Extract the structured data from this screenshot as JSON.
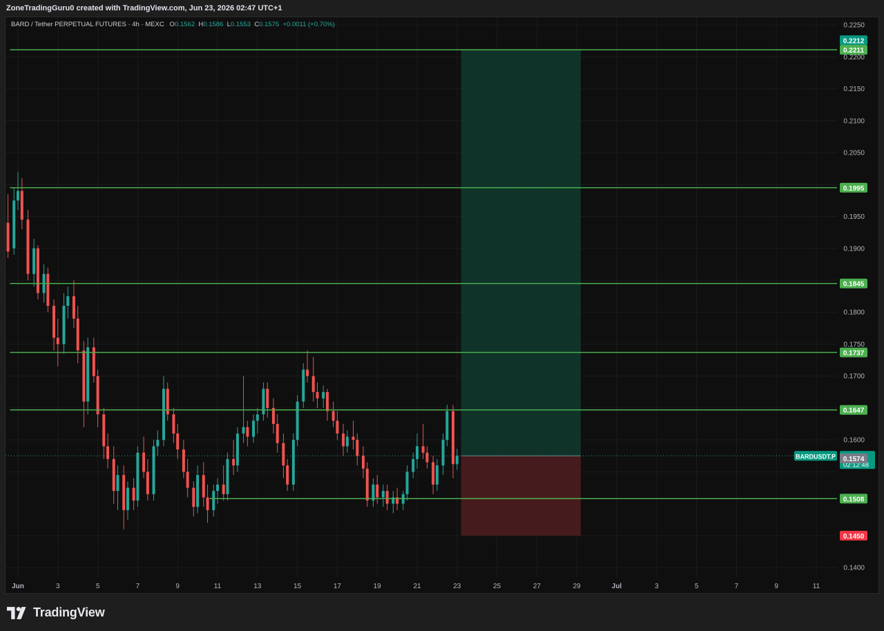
{
  "header": {
    "attribution": "ZoneTradingGuru0 created with TradingView.com, Jun 23, 2026 02:47 UTC+1"
  },
  "legend": {
    "symbol": "BARD / Tether PERPETUAL FUTURES · 4h · MEXC",
    "open_label": "O",
    "open": "0.1562",
    "high_label": "H",
    "high": "0.1586",
    "low_label": "L",
    "low": "0.1553",
    "close_label": "C",
    "close": "0.1575",
    "change": "+0.0011 (+0.70%)"
  },
  "footer": {
    "brand": "TradingView"
  },
  "colors": {
    "up": "#26a69a",
    "down": "#ef5350",
    "level": "#4caf50",
    "target_zone": "#0f3a2e",
    "stop_zone": "#4a1c1f",
    "label_green": "#4caf50",
    "label_teal": "#089981",
    "label_red": "#f23645",
    "label_gray": "#787b86"
  },
  "chart_data": {
    "type": "candlestick",
    "interval": "4h",
    "ylim": [
      0.1385,
      0.2262
    ],
    "y_ticks": [
      0.225,
      0.22,
      0.215,
      0.21,
      0.205,
      0.195,
      0.19,
      0.18,
      0.175,
      0.17,
      0.16,
      0.14
    ],
    "x_ticks": [
      {
        "label": "Jun",
        "day": 1
      },
      {
        "label": "3",
        "day": 3
      },
      {
        "label": "5",
        "day": 5
      },
      {
        "label": "7",
        "day": 7
      },
      {
        "label": "9",
        "day": 9
      },
      {
        "label": "11",
        "day": 11
      },
      {
        "label": "13",
        "day": 13
      },
      {
        "label": "15",
        "day": 15
      },
      {
        "label": "17",
        "day": 17
      },
      {
        "label": "19",
        "day": 19
      },
      {
        "label": "21",
        "day": 21
      },
      {
        "label": "23",
        "day": 23
      },
      {
        "label": "25",
        "day": 25
      },
      {
        "label": "27",
        "day": 27
      },
      {
        "label": "29",
        "day": 29
      },
      {
        "label": "Jul",
        "day": 31
      },
      {
        "label": "3",
        "day": 33
      },
      {
        "label": "5",
        "day": 35
      },
      {
        "label": "7",
        "day": 37
      },
      {
        "label": "9",
        "day": 39
      },
      {
        "label": "11",
        "day": 41
      }
    ],
    "horizontal_levels": [
      {
        "price": 0.2211,
        "label": "0.2211",
        "from_day": 0.6
      },
      {
        "price": 0.1995,
        "label": "0.1995",
        "from_day": 0.6
      },
      {
        "price": 0.1845,
        "label": "0.1845",
        "from_day": 0.6
      },
      {
        "price": 0.1737,
        "label": "0.1737",
        "from_day": 0.6
      },
      {
        "price": 0.1647,
        "label": "0.1647",
        "from_day": 0.6
      },
      {
        "price": 0.1508,
        "label": "0.1508",
        "from_day": 10.6
      }
    ],
    "position": {
      "type": "long",
      "entry": 0.1575,
      "target": 0.2212,
      "stop": 0.145,
      "start_day": 23.2,
      "end_day": 29.2
    },
    "price_labels": [
      {
        "text": "0.2212",
        "price": 0.2226,
        "color": "label_teal"
      },
      {
        "text": "0.2211",
        "price": 0.2211,
        "color": "label_green"
      },
      {
        "text": "0.1995",
        "price": 0.1995,
        "color": "label_green"
      },
      {
        "text": "0.1845",
        "price": 0.1845,
        "color": "label_green"
      },
      {
        "text": "0.1737",
        "price": 0.1737,
        "color": "label_green"
      },
      {
        "text": "0.1647",
        "price": 0.1647,
        "color": "label_green"
      },
      {
        "text": "0.1508",
        "price": 0.1508,
        "color": "label_green"
      },
      {
        "text": "0.1450",
        "price": 0.145,
        "color": "label_red"
      }
    ],
    "last_price": {
      "symbol": "BARDUSDT.P",
      "price": "0.1575",
      "countdown": "02:12:48",
      "price_value": 0.1575
    },
    "mark_price": {
      "text": "0.1574",
      "price": 0.1574
    },
    "candles": [
      {
        "d": 0.5,
        "o": 0.194,
        "h": 0.1985,
        "l": 0.1885,
        "c": 0.1895
      },
      {
        "d": 0.8,
        "o": 0.19,
        "h": 0.1995,
        "l": 0.189,
        "c": 0.1975
      },
      {
        "d": 1.0,
        "o": 0.1975,
        "h": 0.202,
        "l": 0.196,
        "c": 0.199
      },
      {
        "d": 1.2,
        "o": 0.199,
        "h": 0.201,
        "l": 0.193,
        "c": 0.1945
      },
      {
        "d": 1.5,
        "o": 0.1945,
        "h": 0.196,
        "l": 0.185,
        "c": 0.186
      },
      {
        "d": 1.8,
        "o": 0.186,
        "h": 0.1915,
        "l": 0.184,
        "c": 0.19
      },
      {
        "d": 2.0,
        "o": 0.19,
        "h": 0.1905,
        "l": 0.182,
        "c": 0.183
      },
      {
        "d": 2.3,
        "o": 0.183,
        "h": 0.1875,
        "l": 0.1815,
        "c": 0.186
      },
      {
        "d": 2.5,
        "o": 0.186,
        "h": 0.187,
        "l": 0.18,
        "c": 0.181
      },
      {
        "d": 2.8,
        "o": 0.181,
        "h": 0.182,
        "l": 0.174,
        "c": 0.176
      },
      {
        "d": 3.0,
        "o": 0.176,
        "h": 0.179,
        "l": 0.1715,
        "c": 0.175
      },
      {
        "d": 3.3,
        "o": 0.175,
        "h": 0.183,
        "l": 0.1735,
        "c": 0.181
      },
      {
        "d": 3.5,
        "o": 0.181,
        "h": 0.184,
        "l": 0.179,
        "c": 0.1825
      },
      {
        "d": 3.8,
        "o": 0.1825,
        "h": 0.185,
        "l": 0.1775,
        "c": 0.179
      },
      {
        "d": 4.0,
        "o": 0.179,
        "h": 0.181,
        "l": 0.172,
        "c": 0.174
      },
      {
        "d": 4.3,
        "o": 0.174,
        "h": 0.1755,
        "l": 0.162,
        "c": 0.166
      },
      {
        "d": 4.5,
        "o": 0.166,
        "h": 0.176,
        "l": 0.164,
        "c": 0.1745
      },
      {
        "d": 4.8,
        "o": 0.1745,
        "h": 0.176,
        "l": 0.169,
        "c": 0.17
      },
      {
        "d": 5.0,
        "o": 0.17,
        "h": 0.171,
        "l": 0.162,
        "c": 0.164
      },
      {
        "d": 5.3,
        "o": 0.164,
        "h": 0.165,
        "l": 0.157,
        "c": 0.159
      },
      {
        "d": 5.5,
        "o": 0.159,
        "h": 0.161,
        "l": 0.1555,
        "c": 0.157
      },
      {
        "d": 5.8,
        "o": 0.157,
        "h": 0.159,
        "l": 0.15,
        "c": 0.152
      },
      {
        "d": 6.0,
        "o": 0.152,
        "h": 0.156,
        "l": 0.149,
        "c": 0.1545
      },
      {
        "d": 6.3,
        "o": 0.1545,
        "h": 0.156,
        "l": 0.146,
        "c": 0.149
      },
      {
        "d": 6.5,
        "o": 0.149,
        "h": 0.1535,
        "l": 0.1475,
        "c": 0.1525
      },
      {
        "d": 6.8,
        "o": 0.1525,
        "h": 0.154,
        "l": 0.149,
        "c": 0.1505
      },
      {
        "d": 7.0,
        "o": 0.1505,
        "h": 0.159,
        "l": 0.1495,
        "c": 0.158
      },
      {
        "d": 7.3,
        "o": 0.158,
        "h": 0.1605,
        "l": 0.154,
        "c": 0.155
      },
      {
        "d": 7.5,
        "o": 0.155,
        "h": 0.157,
        "l": 0.1505,
        "c": 0.1515
      },
      {
        "d": 7.8,
        "o": 0.1515,
        "h": 0.16,
        "l": 0.1505,
        "c": 0.159
      },
      {
        "d": 8.0,
        "o": 0.159,
        "h": 0.1615,
        "l": 0.1575,
        "c": 0.16
      },
      {
        "d": 8.3,
        "o": 0.16,
        "h": 0.17,
        "l": 0.159,
        "c": 0.168
      },
      {
        "d": 8.5,
        "o": 0.168,
        "h": 0.169,
        "l": 0.163,
        "c": 0.164
      },
      {
        "d": 8.8,
        "o": 0.164,
        "h": 0.165,
        "l": 0.1595,
        "c": 0.161
      },
      {
        "d": 9.0,
        "o": 0.161,
        "h": 0.1625,
        "l": 0.157,
        "c": 0.1585
      },
      {
        "d": 9.3,
        "o": 0.1585,
        "h": 0.16,
        "l": 0.154,
        "c": 0.155
      },
      {
        "d": 9.5,
        "o": 0.155,
        "h": 0.157,
        "l": 0.151,
        "c": 0.1525
      },
      {
        "d": 9.8,
        "o": 0.1525,
        "h": 0.1535,
        "l": 0.148,
        "c": 0.1495
      },
      {
        "d": 10.0,
        "o": 0.1495,
        "h": 0.156,
        "l": 0.1485,
        "c": 0.1545
      },
      {
        "d": 10.3,
        "o": 0.1545,
        "h": 0.1565,
        "l": 0.1495,
        "c": 0.151
      },
      {
        "d": 10.5,
        "o": 0.151,
        "h": 0.153,
        "l": 0.147,
        "c": 0.149
      },
      {
        "d": 10.8,
        "o": 0.149,
        "h": 0.153,
        "l": 0.148,
        "c": 0.152
      },
      {
        "d": 11.0,
        "o": 0.152,
        "h": 0.154,
        "l": 0.15,
        "c": 0.153
      },
      {
        "d": 11.3,
        "o": 0.153,
        "h": 0.156,
        "l": 0.1505,
        "c": 0.1515
      },
      {
        "d": 11.5,
        "o": 0.1515,
        "h": 0.158,
        "l": 0.1505,
        "c": 0.157
      },
      {
        "d": 11.8,
        "o": 0.157,
        "h": 0.16,
        "l": 0.1545,
        "c": 0.156
      },
      {
        "d": 12.0,
        "o": 0.156,
        "h": 0.162,
        "l": 0.155,
        "c": 0.161
      },
      {
        "d": 12.3,
        "o": 0.161,
        "h": 0.17,
        "l": 0.1595,
        "c": 0.162
      },
      {
        "d": 12.5,
        "o": 0.162,
        "h": 0.163,
        "l": 0.159,
        "c": 0.1605
      },
      {
        "d": 12.8,
        "o": 0.1605,
        "h": 0.164,
        "l": 0.1595,
        "c": 0.163
      },
      {
        "d": 13.0,
        "o": 0.163,
        "h": 0.165,
        "l": 0.161,
        "c": 0.164
      },
      {
        "d": 13.3,
        "o": 0.164,
        "h": 0.169,
        "l": 0.163,
        "c": 0.168
      },
      {
        "d": 13.5,
        "o": 0.168,
        "h": 0.169,
        "l": 0.1635,
        "c": 0.165
      },
      {
        "d": 13.8,
        "o": 0.165,
        "h": 0.1665,
        "l": 0.161,
        "c": 0.1625
      },
      {
        "d": 14.0,
        "o": 0.1625,
        "h": 0.164,
        "l": 0.158,
        "c": 0.1595
      },
      {
        "d": 14.3,
        "o": 0.1595,
        "h": 0.161,
        "l": 0.154,
        "c": 0.156
      },
      {
        "d": 14.5,
        "o": 0.156,
        "h": 0.157,
        "l": 0.152,
        "c": 0.153
      },
      {
        "d": 14.8,
        "o": 0.153,
        "h": 0.161,
        "l": 0.152,
        "c": 0.16
      },
      {
        "d": 15.0,
        "o": 0.16,
        "h": 0.167,
        "l": 0.159,
        "c": 0.166
      },
      {
        "d": 15.3,
        "o": 0.166,
        "h": 0.172,
        "l": 0.165,
        "c": 0.171
      },
      {
        "d": 15.5,
        "o": 0.171,
        "h": 0.174,
        "l": 0.169,
        "c": 0.17
      },
      {
        "d": 15.8,
        "o": 0.17,
        "h": 0.173,
        "l": 0.166,
        "c": 0.1675
      },
      {
        "d": 16.0,
        "o": 0.1675,
        "h": 0.169,
        "l": 0.165,
        "c": 0.1665
      },
      {
        "d": 16.3,
        "o": 0.1665,
        "h": 0.1685,
        "l": 0.165,
        "c": 0.1675
      },
      {
        "d": 16.5,
        "o": 0.1675,
        "h": 0.168,
        "l": 0.163,
        "c": 0.1645
      },
      {
        "d": 16.8,
        "o": 0.1645,
        "h": 0.166,
        "l": 0.162,
        "c": 0.163
      },
      {
        "d": 17.0,
        "o": 0.163,
        "h": 0.1645,
        "l": 0.16,
        "c": 0.161
      },
      {
        "d": 17.3,
        "o": 0.161,
        "h": 0.1625,
        "l": 0.1575,
        "c": 0.159
      },
      {
        "d": 17.5,
        "o": 0.159,
        "h": 0.1615,
        "l": 0.158,
        "c": 0.1605
      },
      {
        "d": 17.8,
        "o": 0.1605,
        "h": 0.163,
        "l": 0.1585,
        "c": 0.16
      },
      {
        "d": 18.0,
        "o": 0.16,
        "h": 0.161,
        "l": 0.156,
        "c": 0.1575
      },
      {
        "d": 18.3,
        "o": 0.1575,
        "h": 0.159,
        "l": 0.154,
        "c": 0.1555
      },
      {
        "d": 18.5,
        "o": 0.1555,
        "h": 0.1565,
        "l": 0.1495,
        "c": 0.1505
      },
      {
        "d": 18.8,
        "o": 0.1505,
        "h": 0.154,
        "l": 0.1495,
        "c": 0.153
      },
      {
        "d": 19.0,
        "o": 0.153,
        "h": 0.1545,
        "l": 0.15,
        "c": 0.151
      },
      {
        "d": 19.3,
        "o": 0.151,
        "h": 0.153,
        "l": 0.1495,
        "c": 0.152
      },
      {
        "d": 19.5,
        "o": 0.152,
        "h": 0.153,
        "l": 0.149,
        "c": 0.15
      },
      {
        "d": 19.8,
        "o": 0.15,
        "h": 0.152,
        "l": 0.1485,
        "c": 0.151
      },
      {
        "d": 20.0,
        "o": 0.151,
        "h": 0.1525,
        "l": 0.149,
        "c": 0.15
      },
      {
        "d": 20.3,
        "o": 0.15,
        "h": 0.152,
        "l": 0.149,
        "c": 0.1515
      },
      {
        "d": 20.5,
        "o": 0.1515,
        "h": 0.156,
        "l": 0.1505,
        "c": 0.155
      },
      {
        "d": 20.8,
        "o": 0.155,
        "h": 0.158,
        "l": 0.154,
        "c": 0.157
      },
      {
        "d": 21.0,
        "o": 0.157,
        "h": 0.161,
        "l": 0.1555,
        "c": 0.159
      },
      {
        "d": 21.3,
        "o": 0.159,
        "h": 0.1625,
        "l": 0.157,
        "c": 0.158
      },
      {
        "d": 21.5,
        "o": 0.158,
        "h": 0.159,
        "l": 0.1555,
        "c": 0.1565
      },
      {
        "d": 21.8,
        "o": 0.1565,
        "h": 0.1575,
        "l": 0.1515,
        "c": 0.153
      },
      {
        "d": 22.0,
        "o": 0.153,
        "h": 0.157,
        "l": 0.152,
        "c": 0.156
      },
      {
        "d": 22.3,
        "o": 0.156,
        "h": 0.161,
        "l": 0.1545,
        "c": 0.16
      },
      {
        "d": 22.5,
        "o": 0.16,
        "h": 0.1655,
        "l": 0.159,
        "c": 0.1645
      },
      {
        "d": 22.8,
        "o": 0.1645,
        "h": 0.1655,
        "l": 0.154,
        "c": 0.1562
      },
      {
        "d": 23.0,
        "o": 0.1562,
        "h": 0.1586,
        "l": 0.1553,
        "c": 0.1575
      }
    ]
  }
}
